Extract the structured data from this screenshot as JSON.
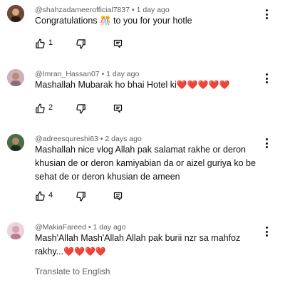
{
  "comments": [
    {
      "author": "@shahzadameerofficial7837",
      "time": "1 day ago",
      "text": "Congratulations 🎊 to you for your hotle",
      "likes": "1",
      "avatar_color": "#5a3b2a"
    },
    {
      "author": "@Imran_Hassan07",
      "time": "1 day ago",
      "text": "Mashallah Mubarak ho bhai Hotel ki",
      "hearts": "❤️❤️❤️❤️❤️",
      "likes": "2",
      "avatar_color": "#c7a6a8"
    },
    {
      "author": "@adreesqureshi63",
      "time": "2 days ago",
      "text": "Mashallah nice vlog Allah pak salamat rakhe or deron khusian de or deron kamiyabian da or aizel guriya ko be sehat de or deron khusian de ameen",
      "likes": "4",
      "avatar_color": "#3d5a3a"
    },
    {
      "author": "@MakiaFareed",
      "time": "1 day ago",
      "text": "Mash'Allah Mash'Allah Allah pak burii nzr sa mahfoz rakhy...",
      "hearts": "❤️❤️❤️❤️",
      "avatar_color": "#e8c4cf"
    }
  ],
  "separator": "•",
  "translate_label": "Translate to English",
  "icons": [
    "thumb-up-icon",
    "thumb-down-icon",
    "reply-icon",
    "more-vert-icon"
  ],
  "colors": {
    "heart": "#e0203a",
    "meta": "#606060",
    "text": "#0f0f0f"
  }
}
